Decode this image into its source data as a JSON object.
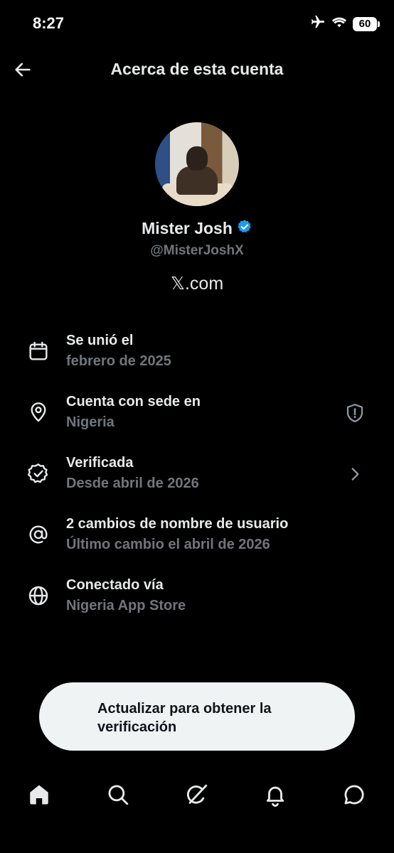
{
  "status": {
    "time": "8:27",
    "battery": "60"
  },
  "header": {
    "title": "Acerca de esta cuenta"
  },
  "profile": {
    "display_name": "Mister Josh",
    "handle": "@MisterJoshX",
    "platform": "𝕏.com",
    "verified_color": "#1d9bf0"
  },
  "info": [
    {
      "icon": "calendar-icon",
      "title": "Se unió el",
      "sub": "febrero de 2025"
    },
    {
      "icon": "location-pin-icon",
      "title": "Cuenta con sede en",
      "sub": "Nigeria",
      "trail": "shield-alert-icon"
    },
    {
      "icon": "verified-badge-icon",
      "title": "Verificada",
      "sub": "Desde abril de 2026",
      "trail": "chevron-right-icon"
    },
    {
      "icon": "at-sign-icon",
      "title": "2 cambios de nombre de usuario",
      "sub": "Último cambio el abril de 2026"
    },
    {
      "icon": "globe-icon",
      "title": "Conectado vía",
      "sub": "Nigeria App Store"
    }
  ],
  "cta": {
    "label": "Actualizar para obtener la verificación"
  },
  "nav": [
    "home-icon",
    "search-icon",
    "grok-icon",
    "notifications-icon",
    "messages-icon"
  ]
}
